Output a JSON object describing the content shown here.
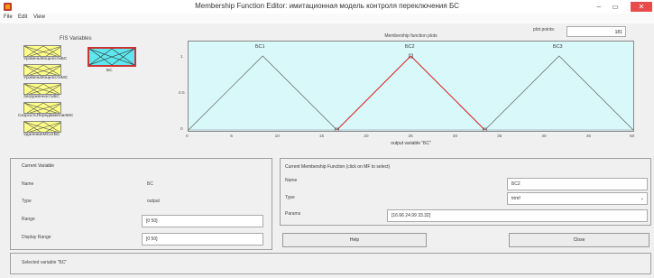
{
  "window": {
    "title": "Membership Function Editor: имитационная модель контроля переключения БС",
    "min_glyph": "–",
    "max_glyph": "▭",
    "close_glyph": "✕"
  },
  "menu": [
    "File",
    "Edit",
    "View"
  ],
  "fis": {
    "heading": "FIS Variables",
    "inputs": [
      "УровеньМощностиБС",
      "УровеньМощностиМС",
      "ЗагруженностьБС",
      "СкоростьПередвиженияМС",
      "УдалениеМСотБС"
    ],
    "output": "БС"
  },
  "plot": {
    "title": "Membership function plots",
    "points_label": "plot points:",
    "points_value": "181",
    "xlabel": "output variable \"БС\"",
    "y_ticks": [
      "1",
      "0.5",
      "0"
    ],
    "x_ticks": [
      "0",
      "5",
      "10",
      "15",
      "20",
      "25",
      "30",
      "35",
      "40",
      "45",
      "50"
    ],
    "mf_labels": [
      "БС1",
      "БС2",
      "БС3"
    ]
  },
  "chart_data": {
    "type": "line",
    "title": "Membership function plots",
    "xlabel": "output variable \"БС\"",
    "ylabel": "",
    "xlim": [
      0,
      50
    ],
    "ylim": [
      0,
      1
    ],
    "series": [
      {
        "name": "БС1",
        "x": [
          -0.01,
          8.34,
          16.68
        ],
        "y": [
          0,
          1,
          0
        ],
        "color": "#606060"
      },
      {
        "name": "БС2",
        "x": [
          16.68,
          24.99,
          33.32
        ],
        "y": [
          0,
          1,
          0
        ],
        "color": "#d62c2c"
      },
      {
        "name": "БС3",
        "x": [
          33.32,
          41.66,
          50.0
        ],
        "y": [
          0,
          1,
          0
        ],
        "color": "#606060"
      }
    ],
    "grid": false
  },
  "current_variable": {
    "title": "Current Variable",
    "name_label": "Name",
    "name_value": "БС",
    "type_label": "Type",
    "type_value": "output",
    "range_label": "Range",
    "range_value": "[0 50]",
    "display_range_label": "Display Range",
    "display_range_value": "[0 50]"
  },
  "current_mf": {
    "title": "Current Membership Function (click on MF to select)",
    "name_label": "Name",
    "name_value": "БС2",
    "type_label": "Type",
    "type_value": "trimf",
    "params_label": "Params",
    "params_value": "[16.66 24.99 33.32]"
  },
  "buttons": {
    "help": "Help",
    "close": "Close"
  },
  "status": "Selected variable \"БС\"",
  "colors": {
    "input_var": "#ffff88",
    "output_var": "#5ee7ee",
    "plot_bg": "#d8f8fa",
    "selected_mf": "#d62c2c"
  }
}
